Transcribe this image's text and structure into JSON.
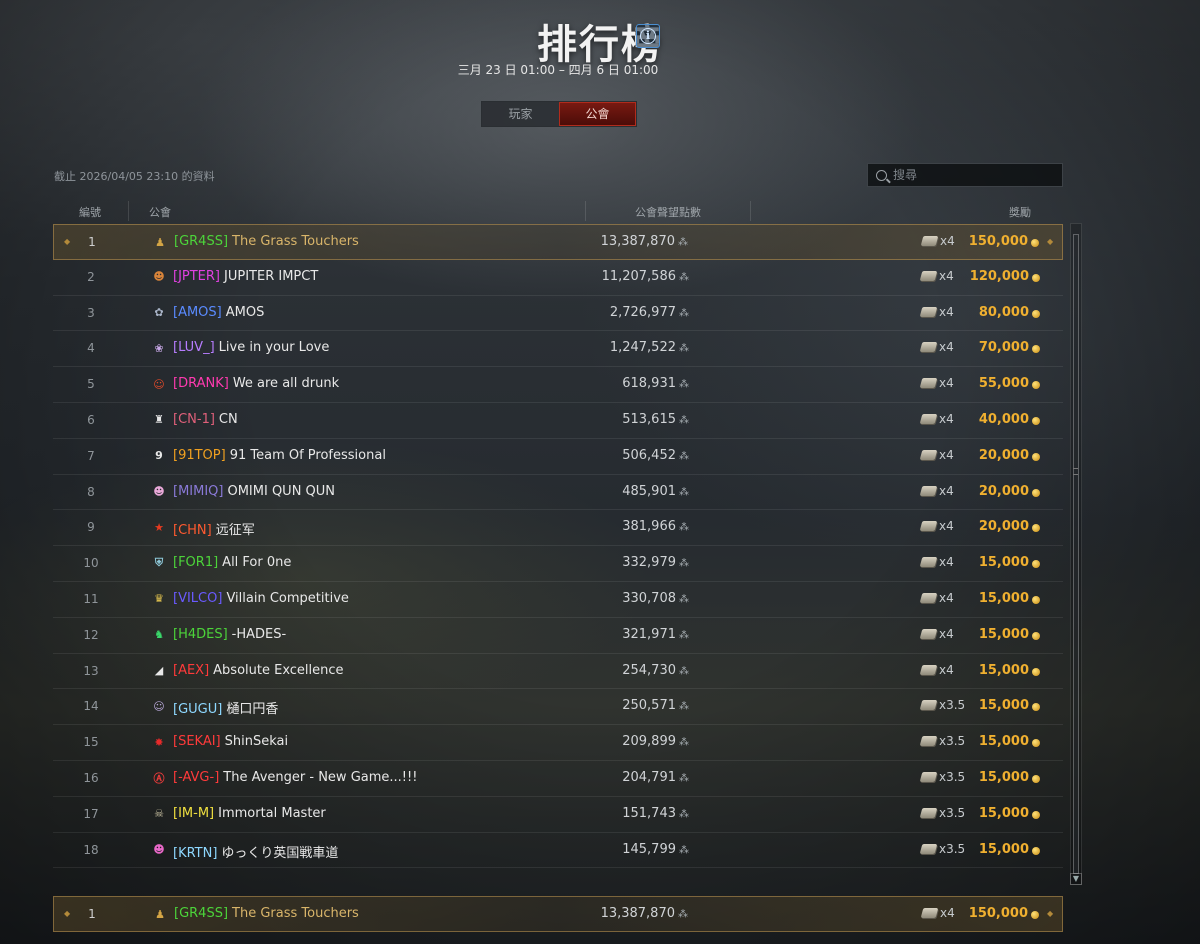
{
  "header": {
    "title": "排行榜",
    "info_icon": "info-icon",
    "date_range": "三月 23 日 01:00 – 四月 6 日 01:00"
  },
  "tabs": [
    {
      "label": "玩家",
      "active": false
    },
    {
      "label": "公會",
      "active": true
    }
  ],
  "as_of": "截止 2026/04/05 23:10 的資料",
  "search": {
    "placeholder": "搜尋"
  },
  "table": {
    "columns": {
      "rank": "編號",
      "clan": "公會",
      "points": "公會聲望點數",
      "reward": "獎勵"
    },
    "rows": [
      {
        "rank": "1",
        "tag": "[GR4SS]",
        "name": "The Grass Touchers",
        "points": "13,387,870",
        "mult": "x4",
        "gold": "150,000",
        "tag_color": "#4cd43a",
        "name_color": "#d9b56a",
        "emblem": "♟",
        "emblem_color": "#d4a545",
        "highlight": true
      },
      {
        "rank": "2",
        "tag": "[JPTER]",
        "name": "JUPITER IMPCT",
        "points": "11,207,586",
        "mult": "x4",
        "gold": "120,000",
        "tag_color": "#e040e0",
        "name_color": "#e8e8e8",
        "emblem": "☻",
        "emblem_color": "#d8843a"
      },
      {
        "rank": "3",
        "tag": "[AMOS]",
        "name": "AMOS",
        "points": "2,726,977",
        "mult": "x4",
        "gold": "80,000",
        "tag_color": "#5a8bff",
        "name_color": "#e8e8e8",
        "emblem": "✿",
        "emblem_color": "#a9b4c8"
      },
      {
        "rank": "4",
        "tag": "[LUV_]",
        "name": "Live in your Love",
        "points": "1,247,522",
        "mult": "x4",
        "gold": "70,000",
        "tag_color": "#b77dff",
        "name_color": "#e8e8e8",
        "emblem": "❀",
        "emblem_color": "#c9a8e8"
      },
      {
        "rank": "5",
        "tag": "[DRANK]",
        "name": "We are all drunk",
        "points": "618,931",
        "mult": "x4",
        "gold": "55,000",
        "tag_color": "#ff3ab0",
        "name_color": "#e8e8e8",
        "emblem": "☺",
        "emblem_color": "#e04a2a"
      },
      {
        "rank": "6",
        "tag": "[CN-1]",
        "name": "CN",
        "points": "513,615",
        "mult": "x4",
        "gold": "40,000",
        "tag_color": "#e0607a",
        "name_color": "#e8e8e8",
        "emblem": "♜",
        "emblem_color": "#e8e8e8"
      },
      {
        "rank": "7",
        "tag": "[91TOP]",
        "name": "91 Team Of Professional",
        "points": "506,452",
        "mult": "x4",
        "gold": "20,000",
        "tag_color": "#f0a020",
        "name_color": "#e8e8e8",
        "emblem": "9",
        "emblem_color": "#e8e8e8"
      },
      {
        "rank": "8",
        "tag": "[MIMIQ]",
        "name": "OMIMI QUN QUN",
        "points": "485,901",
        "mult": "x4",
        "gold": "20,000",
        "tag_color": "#8a7ad8",
        "name_color": "#e8e8e8",
        "emblem": "☻",
        "emblem_color": "#e8a8d8"
      },
      {
        "rank": "9",
        "tag": "[CHN]",
        "name": "远征军",
        "points": "381,966",
        "mult": "x4",
        "gold": "20,000",
        "tag_color": "#ff5a30",
        "name_color": "#e8e8e8",
        "emblem": "★",
        "emblem_color": "#e83a20"
      },
      {
        "rank": "10",
        "tag": "[FOR1]",
        "name": "All For 0ne",
        "points": "332,979",
        "mult": "x4",
        "gold": "15,000",
        "tag_color": "#4cd43a",
        "name_color": "#e8e8e8",
        "emblem": "⛨",
        "emblem_color": "#8ec8d8"
      },
      {
        "rank": "11",
        "tag": "[VILCO]",
        "name": "Villain Competitive",
        "points": "330,708",
        "mult": "x4",
        "gold": "15,000",
        "tag_color": "#6a5aff",
        "name_color": "#e8e8e8",
        "emblem": "♛",
        "emblem_color": "#e8c850"
      },
      {
        "rank": "12",
        "tag": "[H4DES]",
        "name": "-HADES-",
        "points": "321,971",
        "mult": "x4",
        "gold": "15,000",
        "tag_color": "#4cd43a",
        "name_color": "#e8e8e8",
        "emblem": "♞",
        "emblem_color": "#3ad86a"
      },
      {
        "rank": "13",
        "tag": "[AEX]",
        "name": "Absolute Excellence",
        "points": "254,730",
        "mult": "x4",
        "gold": "15,000",
        "tag_color": "#ff3a3a",
        "name_color": "#e8e8e8",
        "emblem": "◢",
        "emblem_color": "#e8e8e8"
      },
      {
        "rank": "14",
        "tag": "[GUGU]",
        "name": "樋口円香",
        "points": "250,571",
        "mult": "x3.5",
        "gold": "15,000",
        "tag_color": "#8ed8ff",
        "name_color": "#e8e8e8",
        "emblem": "☺",
        "emblem_color": "#b8a8d8"
      },
      {
        "rank": "15",
        "tag": "[SEKAI]",
        "name": "ShinSekai",
        "points": "209,899",
        "mult": "x3.5",
        "gold": "15,000",
        "tag_color": "#ff3a3a",
        "name_color": "#e8e8e8",
        "emblem": "✸",
        "emblem_color": "#e82a2a"
      },
      {
        "rank": "16",
        "tag": "[-AVG-]",
        "name": "The Avenger - New Game...!!!",
        "points": "204,791",
        "mult": "x3.5",
        "gold": "15,000",
        "tag_color": "#ff3a3a",
        "name_color": "#e8e8e8",
        "emblem": "Ⓐ",
        "emblem_color": "#e83a3a"
      },
      {
        "rank": "17",
        "tag": "[IM-M]",
        "name": "Immortal Master",
        "points": "151,743",
        "mult": "x3.5",
        "gold": "15,000",
        "tag_color": "#f0e040",
        "name_color": "#e8e8e8",
        "emblem": "☠",
        "emblem_color": "#c8c0a0"
      },
      {
        "rank": "18",
        "tag": "[KRTN]",
        "name": "ゆっくり英国戦車道",
        "points": "145,799",
        "mult": "x3.5",
        "gold": "15,000",
        "tag_color": "#8ed8ff",
        "name_color": "#e8e8e8",
        "emblem": "☻",
        "emblem_color": "#e868c8"
      }
    ]
  },
  "pinned_row": {
    "rank": "1",
    "tag": "[GR4SS]",
    "name": "The Grass Touchers",
    "points": "13,387,870",
    "mult": "x4",
    "gold": "150,000"
  },
  "colors": {
    "accent_tab": "#7a1a12",
    "highlight_border": "#be9650",
    "gold": "#f0b030"
  }
}
